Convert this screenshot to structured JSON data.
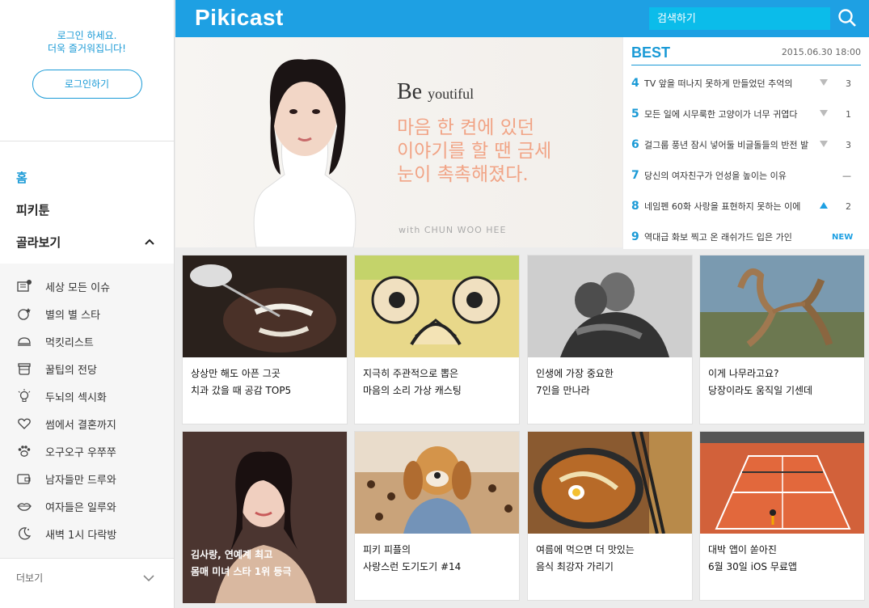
{
  "sidebar": {
    "login_msg_1": "로그인 하세요.",
    "login_msg_2": "더욱 즐거워집니다!",
    "login_button": "로그인하기",
    "nav": [
      {
        "label": "홈"
      },
      {
        "label": "피키툰"
      },
      {
        "label": "골라보기"
      }
    ],
    "categories": [
      {
        "label": "세상 모든 이슈",
        "icon": "news-icon"
      },
      {
        "label": "별의 별 스타",
        "icon": "star-icon"
      },
      {
        "label": "먹킷리스트",
        "icon": "food-icon"
      },
      {
        "label": "꿀팁의 전당",
        "icon": "honey-pot-icon"
      },
      {
        "label": "두뇌의 섹시화",
        "icon": "lightbulb-icon"
      },
      {
        "label": "썸에서 결혼까지",
        "icon": "heart-icon"
      },
      {
        "label": "오구오구 우쭈쭈",
        "icon": "paw-icon"
      },
      {
        "label": "남자들만 드루와",
        "icon": "wallet-icon"
      },
      {
        "label": "여자들은 일루와",
        "icon": "lips-icon"
      },
      {
        "label": "새벽 1시 다락방",
        "icon": "moon-icon"
      }
    ],
    "more_label": "더보기"
  },
  "header": {
    "logo": "Pikicast",
    "search_placeholder": "검색하기",
    "accent": "#1ea0e3"
  },
  "hero": {
    "be": "Be",
    "youtiful": "youtiful",
    "headline": "마음 한 켠에 있던\n이야기를 할 땐 금세\n눈이 촉촉해졌다.",
    "credit": "with CHUN WOO HEE"
  },
  "best": {
    "title": "BEST",
    "date": "2015.06.30 18:00",
    "items": [
      {
        "rank": "4",
        "title": "TV 앞을 떠나지 못하게 만들었던 추억의",
        "trend": "down",
        "change": "3"
      },
      {
        "rank": "5",
        "title": "모든 일에 시무룩한 고양이가 너무 귀엽다",
        "trend": "down",
        "change": "1"
      },
      {
        "rank": "6",
        "title": "걸그룹 풍년 잠시 넣어둘 비글돌들의 반전 발",
        "trend": "down",
        "change": "3"
      },
      {
        "rank": "7",
        "title": "당신의 여자친구가 언성을 높이는 이유",
        "trend": "same",
        "change": "—"
      },
      {
        "rank": "8",
        "title": "네임펜 60화 사랑을 표현하지 못하는 이에",
        "trend": "up",
        "change": "2"
      },
      {
        "rank": "9",
        "title": "역대급 화보 찍고 온 래쉬가드 입은 가인",
        "trend": "new",
        "change": "NEW"
      }
    ]
  },
  "cards": [
    {
      "line1": "상상만 해도 아픈 그곳",
      "line2": "치과 갔을 때 공감 TOP5"
    },
    {
      "line1": "지극히 주관적으로 뽑은",
      "line2": "마음의 소리 가상 캐스팅"
    },
    {
      "line1": "인생에 가장 중요한",
      "line2": "7인을 만나라"
    },
    {
      "line1": "이게 나무라고요?",
      "line2": "당장이라도 움직일 기센데"
    },
    {
      "line1": "김사랑, 연예계 최고",
      "line2": "몸매 미녀 스타 1위 등극"
    },
    {
      "line1": "피키 피플의",
      "line2": "사랑스런 도기도기 #14"
    },
    {
      "line1": "여름에 먹으면 더 맛있는",
      "line2": "음식 최강자 가리기"
    },
    {
      "line1": "대박 앱이 쏟아진",
      "line2": "6월 30일 iOS 무료앱"
    }
  ]
}
